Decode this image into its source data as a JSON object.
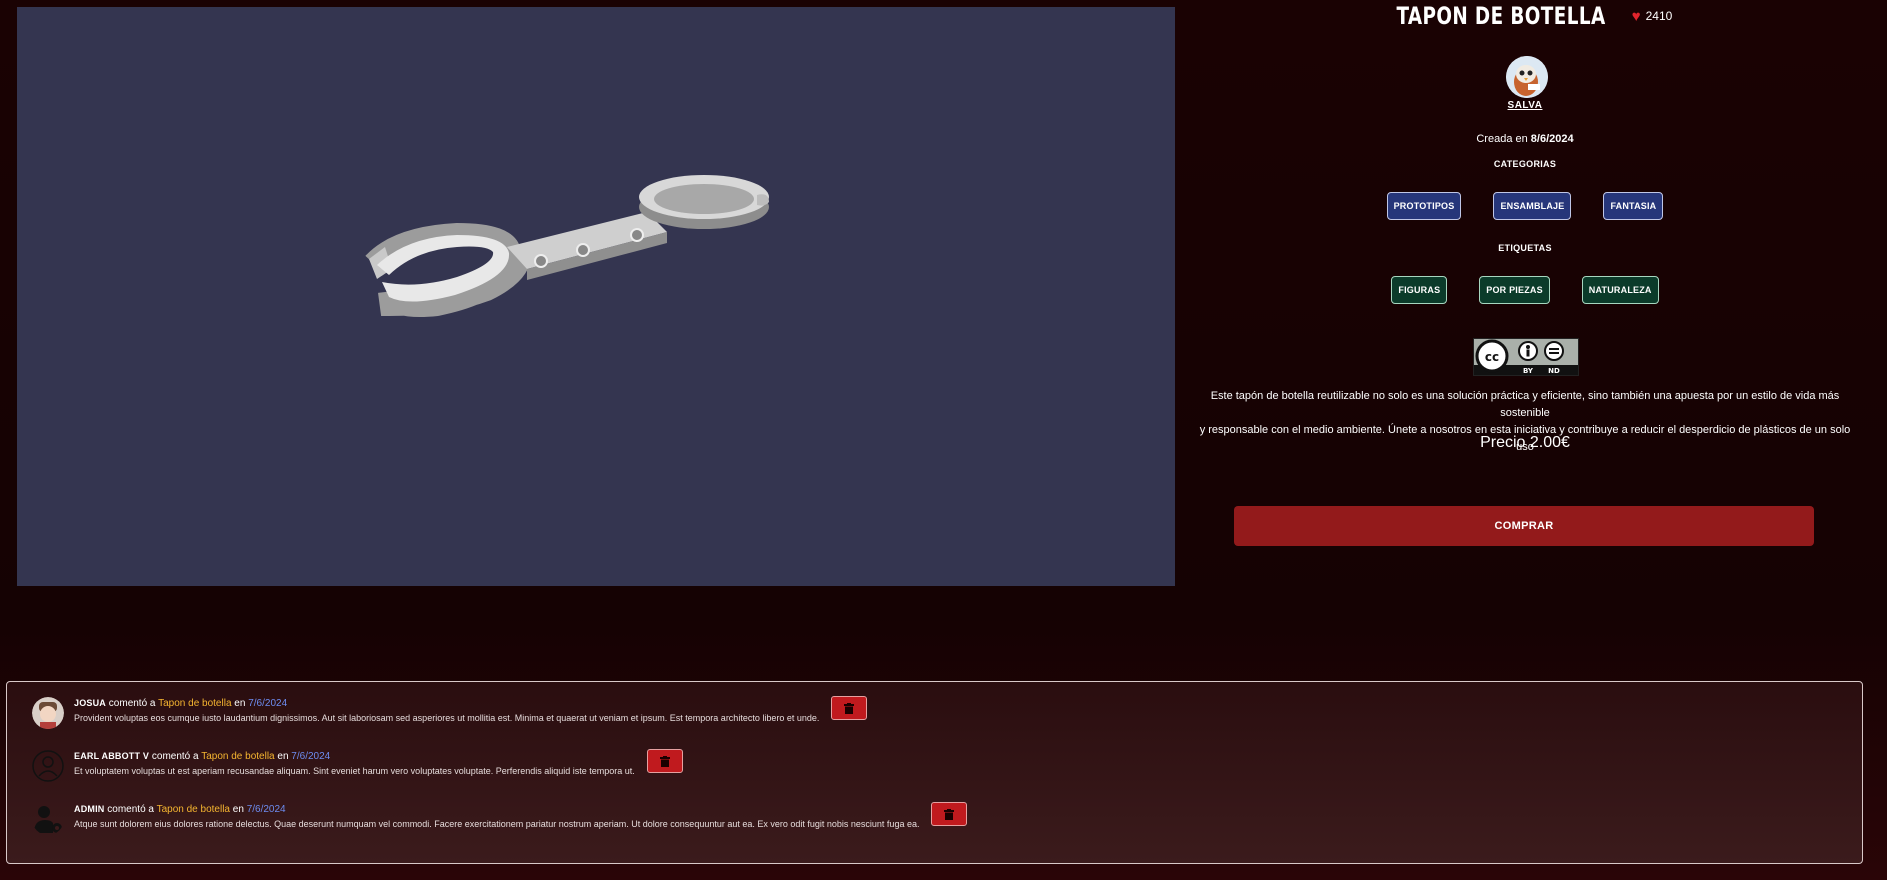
{
  "product": {
    "title": "TAPON DE BOTELLA",
    "likes": "2410",
    "author": "SALVA",
    "created_prefix": "Creada en",
    "created_date": "8/6/2024",
    "categories_label": "CATEGORIAS",
    "categories": [
      "PROTOTIPOS",
      "ENSAMBLAJE",
      "FANTASIA"
    ],
    "tags_label": "ETIQUETAS",
    "tags": [
      "FIGURAS",
      "POR PIEZAS",
      "NATURALEZA"
    ],
    "license": {
      "mark": "cc",
      "by": "BY",
      "nd": "ND"
    },
    "description_line1": "Este tapón de botella reutilizable no solo es una solución práctica y eficiente, sino también una apuesta por un estilo de vida más sostenible",
    "description_line2": "y responsable con el medio ambiente. Únete a nosotros en esta iniciativa y contribuye a reducir el desperdicio de plásticos de un solo uso",
    "price": "Precio 2.00€",
    "buy_label": "COMPRAR"
  },
  "comments": [
    {
      "user": "JOSUA",
      "verb": "comentó a",
      "post": "Tapon de botella",
      "prep": "en",
      "date": "7/6/2024",
      "body": "Provident voluptas eos cumque iusto laudantium dignissimos. Aut sit laboriosam sed asperiores ut mollitia est. Minima et quaerat ut veniam et ipsum. Est tempora architecto libero et unde."
    },
    {
      "user": "EARL ABBOTT V",
      "verb": "comentó a",
      "post": "Tapon de botella",
      "prep": "en",
      "date": "7/6/2024",
      "body": "Et voluptatem voluptas ut est aperiam recusandae aliquam. Sint eveniet harum vero voluptates voluptate. Perferendis aliquid iste tempora ut."
    },
    {
      "user": "ADMIN",
      "verb": "comentó a",
      "post": "Tapon de botella",
      "prep": "en",
      "date": "7/6/2024",
      "body": "Atque sunt dolorem eius dolores ratione delectus. Quae deserunt numquam vel commodi. Facere exercitationem pariatur nostrum aperiam. Ut dolore consequuntur aut ea. Ex vero odit fugit nobis nesciunt fuga ea."
    }
  ],
  "icons": {
    "like": "heart-icon",
    "delete": "trash-icon"
  },
  "colors": {
    "accent": "#931a1b",
    "category": "#26367a",
    "tag": "#0b3b2a",
    "post_link": "#f5b530",
    "date_link": "#6d8cf0"
  }
}
